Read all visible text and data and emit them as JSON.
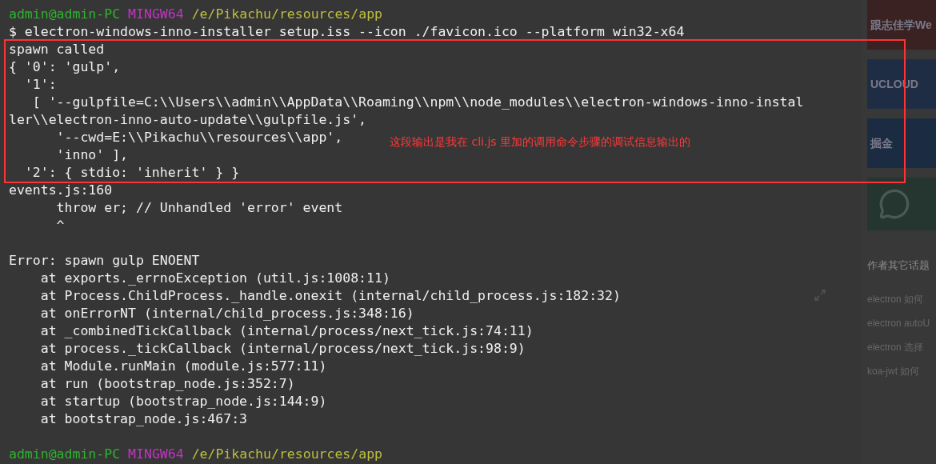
{
  "terminal": {
    "lines": [
      {
        "kind": "prompt",
        "user": "admin@admin-PC",
        "shell": "MINGW64",
        "path": "/e/Pikachu/resources/app"
      },
      {
        "kind": "text",
        "text": "$ electron-windows-inno-installer setup.iss --icon ./favicon.ico --platform win32-x64"
      },
      {
        "kind": "text",
        "text": "spawn called"
      },
      {
        "kind": "text",
        "text": "{ '0': 'gulp',"
      },
      {
        "kind": "text",
        "text": "  '1':"
      },
      {
        "kind": "text",
        "text": "   [ '--gulpfile=C:\\\\Users\\\\admin\\\\AppData\\\\Roaming\\\\npm\\\\node_modules\\\\electron-windows-inno-instal"
      },
      {
        "kind": "text",
        "text": "ler\\\\electron-inno-auto-update\\\\gulpfile.js',"
      },
      {
        "kind": "text",
        "text": "      '--cwd=E:\\\\Pikachu\\\\resources\\\\app',"
      },
      {
        "kind": "text",
        "text": "      'inno' ],"
      },
      {
        "kind": "text",
        "text": "  '2': { stdio: 'inherit' } }"
      },
      {
        "kind": "text",
        "text": "events.js:160"
      },
      {
        "kind": "text",
        "text": "      throw er; // Unhandled 'error' event"
      },
      {
        "kind": "text",
        "text": "      ^"
      },
      {
        "kind": "blank"
      },
      {
        "kind": "text",
        "text": "Error: spawn gulp ENOENT"
      },
      {
        "kind": "text",
        "text": "    at exports._errnoException (util.js:1008:11)"
      },
      {
        "kind": "text",
        "text": "    at Process.ChildProcess._handle.onexit (internal/child_process.js:182:32)"
      },
      {
        "kind": "text",
        "text": "    at onErrorNT (internal/child_process.js:348:16)"
      },
      {
        "kind": "text",
        "text": "    at _combinedTickCallback (internal/process/next_tick.js:74:11)"
      },
      {
        "kind": "text",
        "text": "    at process._tickCallback (internal/process/next_tick.js:98:9)"
      },
      {
        "kind": "text",
        "text": "    at Module.runMain (module.js:577:11)"
      },
      {
        "kind": "text",
        "text": "    at run (bootstrap_node.js:352:7)"
      },
      {
        "kind": "text",
        "text": "    at startup (bootstrap_node.js:144:9)"
      },
      {
        "kind": "text",
        "text": "    at bootstrap_node.js:467:3"
      },
      {
        "kind": "blank"
      },
      {
        "kind": "prompt",
        "user": "admin@admin-PC",
        "shell": "MINGW64",
        "path": "/e/Pikachu/resources/app"
      }
    ]
  },
  "annotation": {
    "note": "这段输出是我在 cli.js 里加的调用命令步骤的调试信息输出的"
  },
  "sidebar": {
    "banners": [
      {
        "kind": "text",
        "text": "跟志佳学We",
        "color": "#3a2222"
      },
      {
        "kind": "text",
        "text": "UCLOUD",
        "color": "#1f2d44"
      },
      {
        "kind": "text",
        "text": "掘金",
        "color": "#1b2c42"
      },
      {
        "kind": "chat",
        "color": "#24362f"
      }
    ],
    "section_title": "作者其它话题",
    "topics": [
      "electron 如何",
      "electron autoU",
      "electron 选择",
      "koa-jwt 如何"
    ]
  }
}
